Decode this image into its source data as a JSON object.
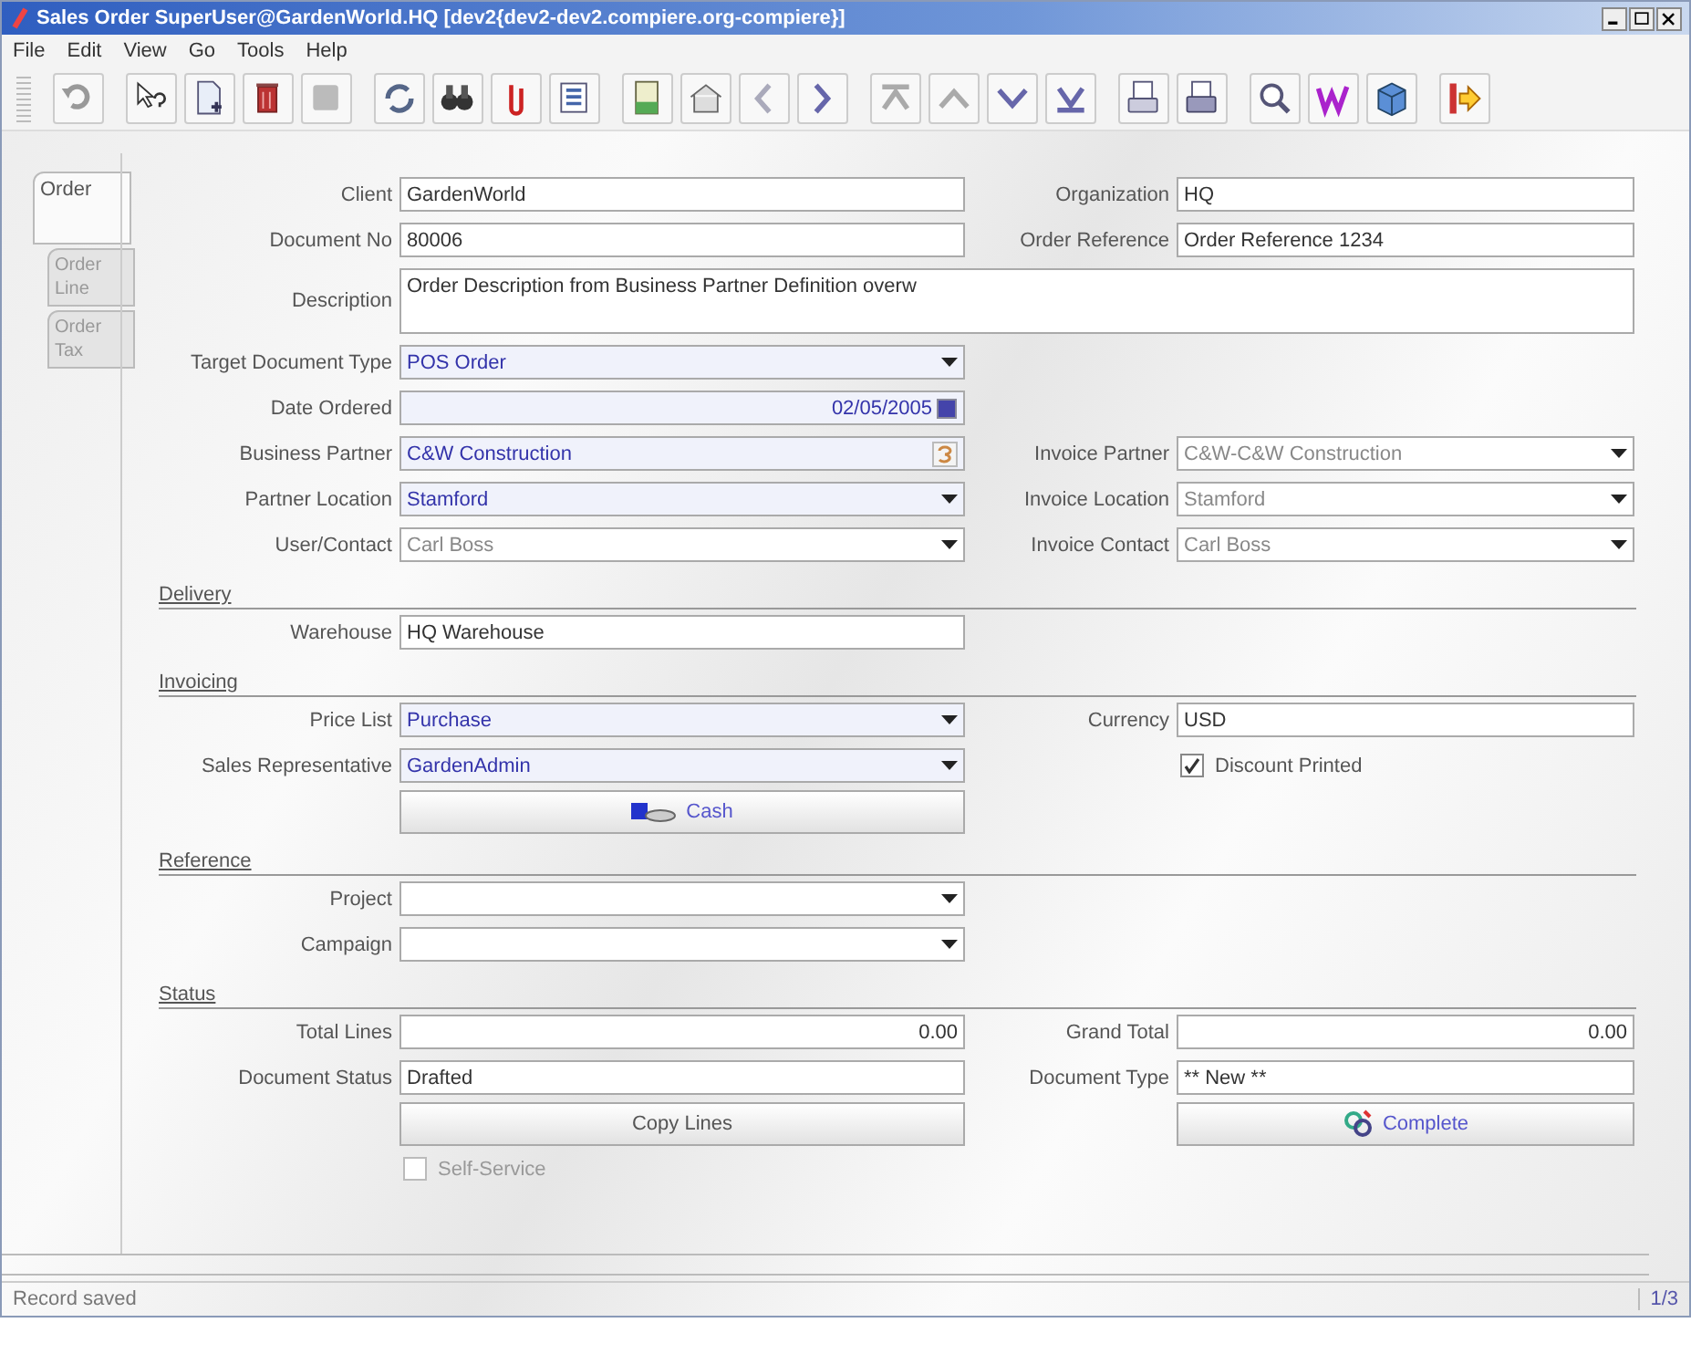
{
  "window": {
    "title": "Sales Order  SuperUser@GardenWorld.HQ [dev2{dev2-dev2.compiere.org-compiere}]"
  },
  "menu": [
    "File",
    "Edit",
    "View",
    "Go",
    "Tools",
    "Help"
  ],
  "tabs": [
    {
      "label": "Order",
      "selected": true
    },
    {
      "label": "Order Line",
      "selected": false
    },
    {
      "label": "Order Tax",
      "selected": false
    }
  ],
  "rows": [
    {
      "kind": "fields",
      "left": {
        "label": "Client",
        "kind": "text",
        "value": "GardenWorld"
      },
      "right": {
        "label": "Organization",
        "kind": "text",
        "value": "HQ"
      }
    },
    {
      "kind": "fields",
      "left": {
        "label": "Document No",
        "kind": "text",
        "value": "80006"
      },
      "right": {
        "label": "Order Reference",
        "kind": "text",
        "value": "Order Reference 1234"
      }
    },
    {
      "kind": "wide",
      "left": {
        "label": "Description",
        "kind": "textarea",
        "value": "Order Description from Business Partner Definition overw"
      }
    },
    {
      "kind": "fields",
      "left": {
        "label": "Target Document Type",
        "kind": "combo",
        "value": "POS Order",
        "mandatory": true
      }
    },
    {
      "kind": "fields",
      "left": {
        "label": "Date Ordered",
        "kind": "date",
        "value": "02/05/2005",
        "mandatory": true
      }
    },
    {
      "kind": "fields",
      "left": {
        "label": "Business Partner",
        "kind": "search",
        "value": "C&W Construction",
        "mandatory": true
      },
      "right": {
        "label": "Invoice Partner",
        "kind": "combo",
        "value": "C&W-C&W Construction",
        "readonly": true
      }
    },
    {
      "kind": "fields",
      "left": {
        "label": "Partner Location",
        "kind": "combo",
        "value": "Stamford",
        "mandatory": true
      },
      "right": {
        "label": "Invoice Location",
        "kind": "combo",
        "value": "Stamford",
        "readonly": true
      }
    },
    {
      "kind": "fields",
      "left": {
        "label": "User/Contact",
        "kind": "combo",
        "value": "Carl Boss",
        "readonly": true
      },
      "right": {
        "label": "Invoice Contact",
        "kind": "combo",
        "value": "Carl Boss",
        "readonly": true
      }
    },
    {
      "kind": "section",
      "title": "Delivery"
    },
    {
      "kind": "fields",
      "left": {
        "label": "Warehouse",
        "kind": "text",
        "value": "HQ Warehouse"
      }
    },
    {
      "kind": "section",
      "title": "Invoicing"
    },
    {
      "kind": "fields",
      "left": {
        "label": "Price List",
        "kind": "combo",
        "value": "Purchase",
        "mandatory": true
      },
      "right": {
        "label": "Currency",
        "kind": "text",
        "value": "USD"
      }
    },
    {
      "kind": "fields",
      "left": {
        "label": "Sales Representative",
        "kind": "combo",
        "value": "GardenAdmin",
        "mandatory": true
      },
      "right": {
        "kind": "checkbox",
        "label": "Discount Printed",
        "checked": true,
        "disabled": false
      }
    },
    {
      "kind": "fields",
      "left": {
        "kind": "action",
        "label": "Cash"
      }
    },
    {
      "kind": "section",
      "title": "Reference"
    },
    {
      "kind": "fields",
      "left": {
        "label": "Project",
        "kind": "combo"
      }
    },
    {
      "kind": "fields",
      "left": {
        "label": "Campaign",
        "kind": "combo"
      }
    },
    {
      "kind": "section",
      "title": "Status"
    },
    {
      "kind": "fields",
      "left": {
        "label": "Total Lines",
        "kind": "number",
        "value": "0.00"
      },
      "right": {
        "label": "Grand Total",
        "kind": "number",
        "value": "0.00"
      }
    },
    {
      "kind": "fields",
      "left": {
        "label": "Document Status",
        "kind": "text",
        "value": "Drafted"
      },
      "right": {
        "label": "Document Type",
        "kind": "text",
        "value": "** New **"
      }
    },
    {
      "kind": "fields",
      "left": {
        "kind": "button",
        "label": "Copy Lines"
      },
      "right": {
        "kind": "action",
        "label": "Complete"
      }
    },
    {
      "kind": "fields",
      "left": {
        "kind": "checkbox",
        "label": "Self-Service",
        "checked": false,
        "disabled": true
      }
    }
  ],
  "status_bar": {
    "message": "Record saved",
    "record": "1/3"
  }
}
